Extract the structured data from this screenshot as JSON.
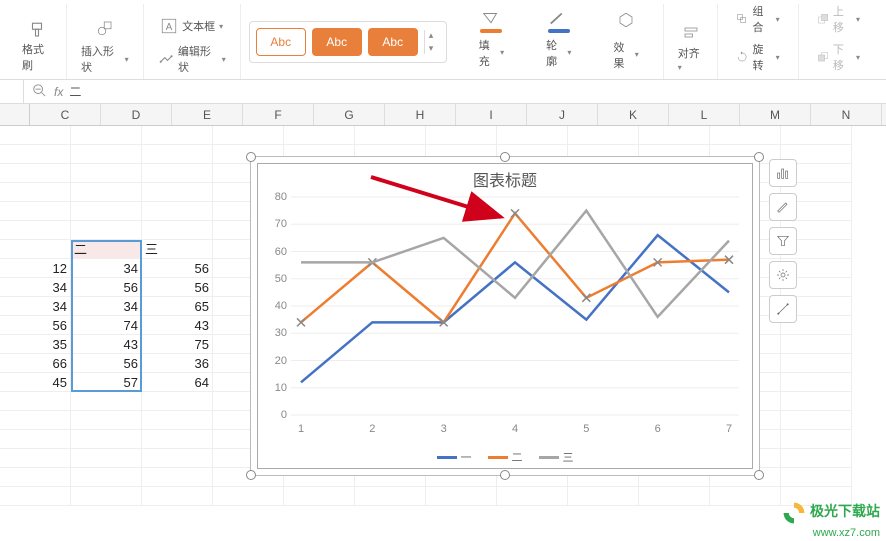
{
  "ribbon": {
    "format_brush": "格式刷",
    "insert_shape": "插入形状",
    "text_box": "文本框",
    "edit_shape": "编辑形状",
    "style_label": "Abc",
    "fill": "填充",
    "outline": "轮廓",
    "effect": "效果",
    "align": "对齐",
    "group": "组合",
    "rotate": "旋转",
    "bring_front": "上移",
    "send_back": "下移"
  },
  "formula_bar": {
    "fx": "fx",
    "value": "二"
  },
  "columns": [
    "C",
    "D",
    "E",
    "F",
    "G",
    "H",
    "I",
    "J",
    "K",
    "L",
    "M",
    "N"
  ],
  "table": {
    "headers": [
      "二",
      "三"
    ],
    "rows": [
      {
        "c": "12",
        "d": "34",
        "e": "56"
      },
      {
        "c": "34",
        "d": "56",
        "e": "56"
      },
      {
        "c": "34",
        "d": "34",
        "e": "65"
      },
      {
        "c": "56",
        "d": "74",
        "e": "43"
      },
      {
        "c": "35",
        "d": "43",
        "e": "75"
      },
      {
        "c": "66",
        "d": "56",
        "e": "36"
      },
      {
        "c": "45",
        "d": "57",
        "e": "64"
      }
    ]
  },
  "chart_data": {
    "type": "line",
    "title": "图表标题",
    "xlabel": "",
    "ylabel": "",
    "ylim": [
      0,
      80
    ],
    "y_ticks": [
      0,
      10,
      20,
      30,
      40,
      50,
      60,
      70,
      80
    ],
    "categories": [
      "1",
      "2",
      "3",
      "4",
      "5",
      "6",
      "7"
    ],
    "series": [
      {
        "name": "一",
        "color": "#4472c4",
        "values": [
          12,
          34,
          34,
          56,
          35,
          66,
          45
        ]
      },
      {
        "name": "二",
        "color": "#ed7d31",
        "values": [
          34,
          56,
          34,
          74,
          43,
          56,
          57
        ],
        "selected": true
      },
      {
        "name": "三",
        "color": "#a6a6a6",
        "values": [
          56,
          56,
          65,
          43,
          75,
          36,
          64
        ]
      }
    ],
    "legend_position": "bottom"
  },
  "side_tools": {
    "chart_elements": "chart-elements",
    "style": "chart-style",
    "filter": "chart-filter",
    "settings": "chart-settings",
    "tools": "chart-tools"
  },
  "watermark": {
    "title": "极光下载站",
    "url": "www.xz7.com"
  }
}
